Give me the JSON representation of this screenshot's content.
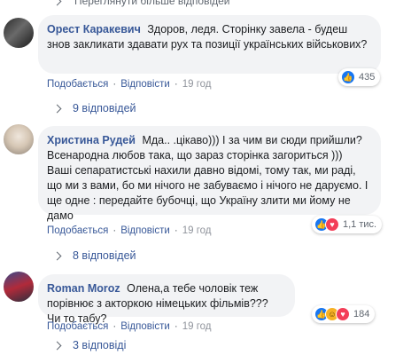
{
  "top_link": {
    "label": "Переглянути більше відповідей"
  },
  "comments": [
    {
      "author": "Орест Каракевич",
      "text": "Здоров, ледя. Сторінку завела - будеш знов закликати здавати рух та позиції українських військових?",
      "like_label": "Подобається",
      "reply_label": "Відповісти",
      "time": "19 год",
      "reactions": {
        "icons": [
          "like-icon"
        ],
        "count": "435"
      },
      "replies_label": "9 відповідей"
    },
    {
      "author": "Христина Рудей",
      "text": "Мда.. .цікаво))) І за чим ви сюди прийшли? Всенародна любов така, що зараз сторінка загориться ))) Ваші сепаратистські нахили давно відомі, тому так, ми раді, що ми з вами, бо ми нічого не забуваємо і нічого не даруємо. І ще одне : передайте бубочці, що Україну злити ми йому не дамо",
      "like_label": "Подобається",
      "reply_label": "Відповісти",
      "time": "19 год",
      "reactions": {
        "icons": [
          "like-icon",
          "love-icon"
        ],
        "count": "1,1 тис."
      },
      "replies_label": "8 відповідей"
    },
    {
      "author": "Roman Moroz",
      "text": "Олена,а тебе чоловік теж порівнює з акторкою німецьких фільмів??? Чи то табу?",
      "like_label": "Подобається",
      "reply_label": "Відповісти",
      "time": "19 год",
      "reactions": {
        "icons": [
          "like-icon",
          "haha-icon",
          "love-icon"
        ],
        "count": "184"
      },
      "replies_label": "3 відповіді"
    }
  ],
  "separator": "·",
  "colors": {
    "link": "#385898",
    "bubble": "#f2f3f5",
    "like": "#1877f2",
    "love": "#f33e58",
    "haha": "#f7b125"
  }
}
